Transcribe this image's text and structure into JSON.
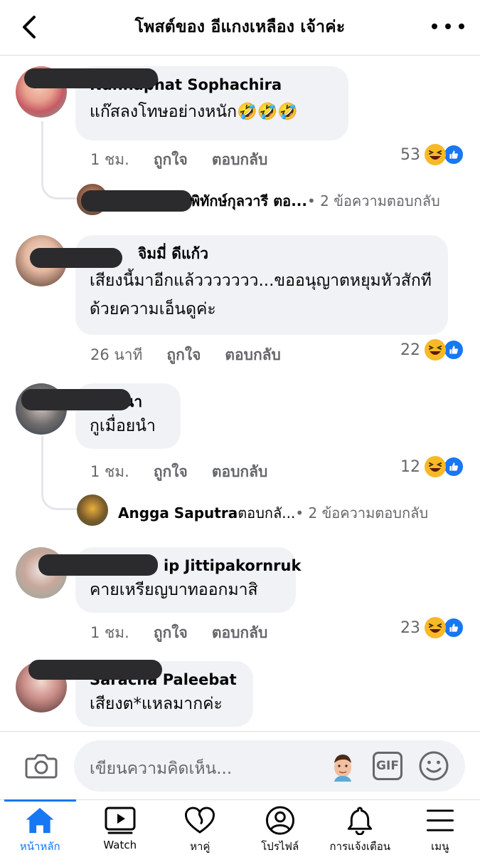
{
  "header": {
    "title": "โพสต์ของ อีแกงเหลือง เจ้าค่ะ"
  },
  "comments": [
    {
      "author": "Nannaphat Sophachira",
      "text": "แก๊สลงโทษอย่างหนัก🤣🤣🤣",
      "time": "1 ชม.",
      "like": "ถูกใจ",
      "reply": "ตอบกลับ",
      "reactions": "53",
      "reply_preview": {
        "name": "พิทักษ์กุลวารี ตอ...",
        "more": " • 2 ข้อความตอบกลับ"
      }
    },
    {
      "author": "จิมมี่ ดีแก้ว",
      "text": "เสียงนี้มาอีกแล้ววววววว...ขออนุญาตหยุมหัวสักทีด้วยความเอ็นดูค่ะ",
      "time": "26 นาที",
      "like": "ถูกใจ",
      "reply": "ตอบกลับ",
      "reactions": "22"
    },
    {
      "author": "นา",
      "text": "กูเมื่อยนำ",
      "time": "1 ชม.",
      "like": "ถูกใจ",
      "reply": "ตอบกลับ",
      "reactions": "12",
      "reply_preview": {
        "name": "Angga Saputra",
        "action": " ตอบกลั...",
        "more": " • 2 ข้อความตอบกลับ"
      }
    },
    {
      "author": "ip Jittipakornruk",
      "text": "คายเหรียญบาทออกมาสิ",
      "time": "1 ชม.",
      "like": "ถูกใจ",
      "reply": "ตอบกลับ",
      "reactions": "23"
    },
    {
      "author": "Saracha Paleebat",
      "text": "เสียงต*แหลมากค่ะ"
    }
  ],
  "composer": {
    "placeholder": "เขียนความคิดเห็น...",
    "gif_label": "GIF"
  },
  "nav": [
    {
      "label": "หน้าหลัก",
      "icon": "home-icon",
      "active": true
    },
    {
      "label": "Watch",
      "icon": "watch-icon"
    },
    {
      "label": "หาคู่",
      "icon": "dating-heart-icon"
    },
    {
      "label": "โปรไฟล์",
      "icon": "profile-icon"
    },
    {
      "label": "การแจ้งเตือน",
      "icon": "bell-icon"
    },
    {
      "label": "เมนู",
      "icon": "menu-icon"
    }
  ],
  "colors": {
    "accent": "#1877f2",
    "bubble": "#f0f2f5",
    "muted_text": "#65676b",
    "haha": "#f7b928"
  }
}
